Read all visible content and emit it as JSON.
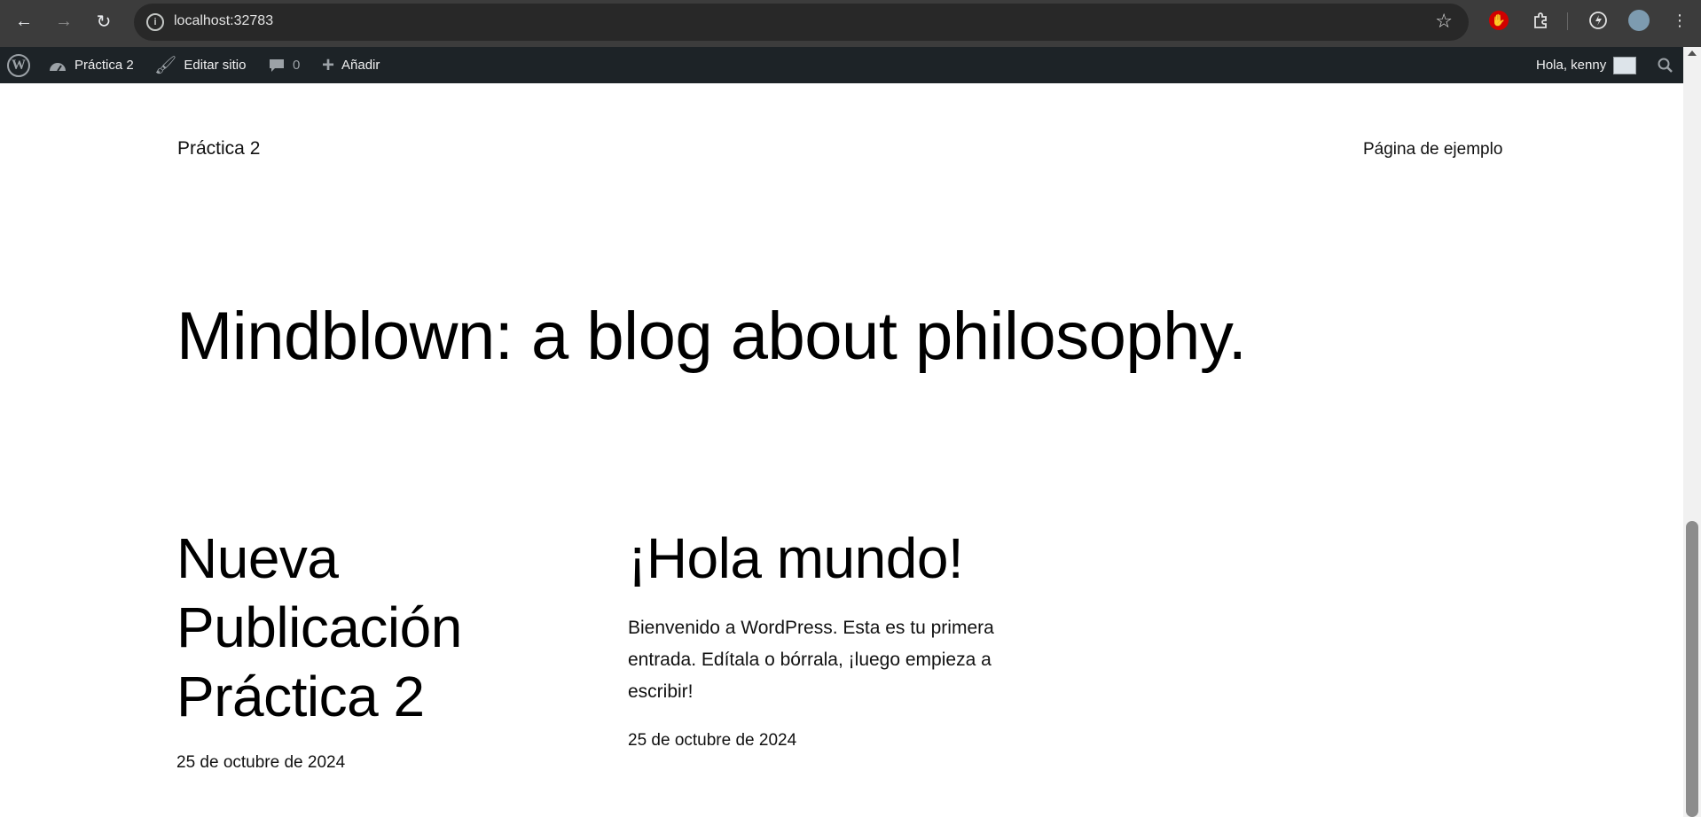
{
  "browser": {
    "url": "localhost:32783",
    "back_icon": "arrow-left-icon",
    "forward_icon": "arrow-right-icon",
    "reload_icon": "reload-icon",
    "site_info_icon": "info-icon",
    "bookmark_icon": "star-icon",
    "extensions": [
      "red-hand-extension-icon",
      "puzzle-extensions-icon",
      "performance-icon",
      "profile-avatar-icon",
      "kebab-menu-icon"
    ]
  },
  "admin_bar": {
    "site_name": "Práctica 2",
    "edit_site": "Editar sitio",
    "comments_count": "0",
    "add_new": "Añadir",
    "greeting": "Hola, kenny"
  },
  "site": {
    "title": "Práctica 2",
    "nav_link": "Página de ejemplo",
    "tagline": "Mindblown: a blog about philosophy."
  },
  "posts": [
    {
      "title_lines": [
        "Nueva",
        "Publicación",
        "Práctica 2"
      ],
      "excerpt": "",
      "date": "25 de octubre de 2024"
    },
    {
      "title_lines": [
        "¡Hola mundo!"
      ],
      "excerpt_lines": [
        "Bienvenido a WordPress. Esta es tu primera",
        "entrada. Edítala o bórrala, ¡luego empieza a",
        "escribir!"
      ],
      "date": "25 de octubre de 2024"
    }
  ],
  "colors": {
    "browser_bg": "#3c3c3c",
    "omnibox_bg": "#282828",
    "admin_bar_bg": "#1d2327",
    "page_bg": "#ffffff",
    "text": "#111111"
  }
}
